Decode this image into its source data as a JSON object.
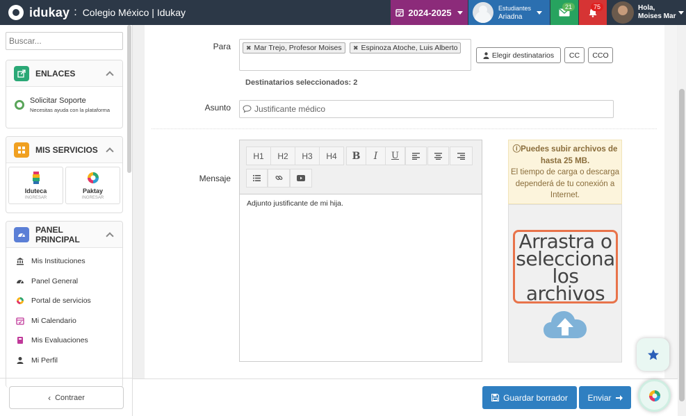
{
  "header": {
    "brand": "idukay",
    "separator": ":",
    "school": "Colegio México | Idukay",
    "year": "2024-2025",
    "students_label": "Estudiantes",
    "student_name": "Ariadna",
    "messages_count": "21",
    "notifications_count": "75",
    "greeting": "Hola,",
    "user_name": "Moises Mar"
  },
  "sidebar": {
    "search_placeholder": "Buscar...",
    "links_title": "ENLACES",
    "support_title": "Solicitar Soporte",
    "support_sub": "Necesitas ayuda con la plataforma",
    "services_title": "MIS SERVICIOS",
    "services": [
      {
        "name": "Iduteca",
        "action": "INGRESAR"
      },
      {
        "name": "Paktay",
        "action": "INGRESAR"
      }
    ],
    "panel_title": "PANEL PRINCIPAL",
    "menu": [
      {
        "label": "Mis Instituciones",
        "icon": "bank-icon"
      },
      {
        "label": "Panel General",
        "icon": "dashboard-icon"
      },
      {
        "label": "Portal de servicios",
        "icon": "services-logo-icon"
      },
      {
        "label": "Mi Calendario",
        "icon": "calendar-icon"
      },
      {
        "label": "Mis Evaluaciones",
        "icon": "evaluations-icon"
      },
      {
        "label": "Mi Perfil",
        "icon": "user-icon"
      }
    ],
    "collapse_label": "Contraer"
  },
  "form": {
    "to_label": "Para",
    "recipients": [
      "Mar Trejo, Profesor Moises",
      "Espinoza Atoche, Luis Alberto"
    ],
    "choose_recipients": "Elegir destinatarios",
    "cc": "CC",
    "cco": "CCO",
    "selected_count": "Destinatarios seleccionados: 2",
    "subject_label": "Asunto",
    "subject_value": "Justificante médico",
    "message_label": "Mensaje",
    "toolbar": {
      "h1": "H1",
      "h2": "H2",
      "h3": "H3",
      "h4": "H4",
      "bold": "B",
      "italic": "I",
      "underline": "U"
    },
    "message_body": "Adjunto justificante de mi hija."
  },
  "attachments": {
    "info_bold": "Puedes subir archivos de hasta 25 MB.",
    "info_text": "El tiempo de carga o descarga dependerá de tu conexión a Internet.",
    "drop_text": "Arrastra o selecciona los archivos"
  },
  "actions": {
    "save_draft": "Guardar borrador",
    "send": "Enviar"
  },
  "colors": {
    "topbar": "#2c3847",
    "year": "#8c2b7a",
    "student": "#2b6fb0",
    "messages": "#27a35f",
    "notifications": "#d63434",
    "primary": "#2f7fc1",
    "drop_border": "#e8734a"
  }
}
